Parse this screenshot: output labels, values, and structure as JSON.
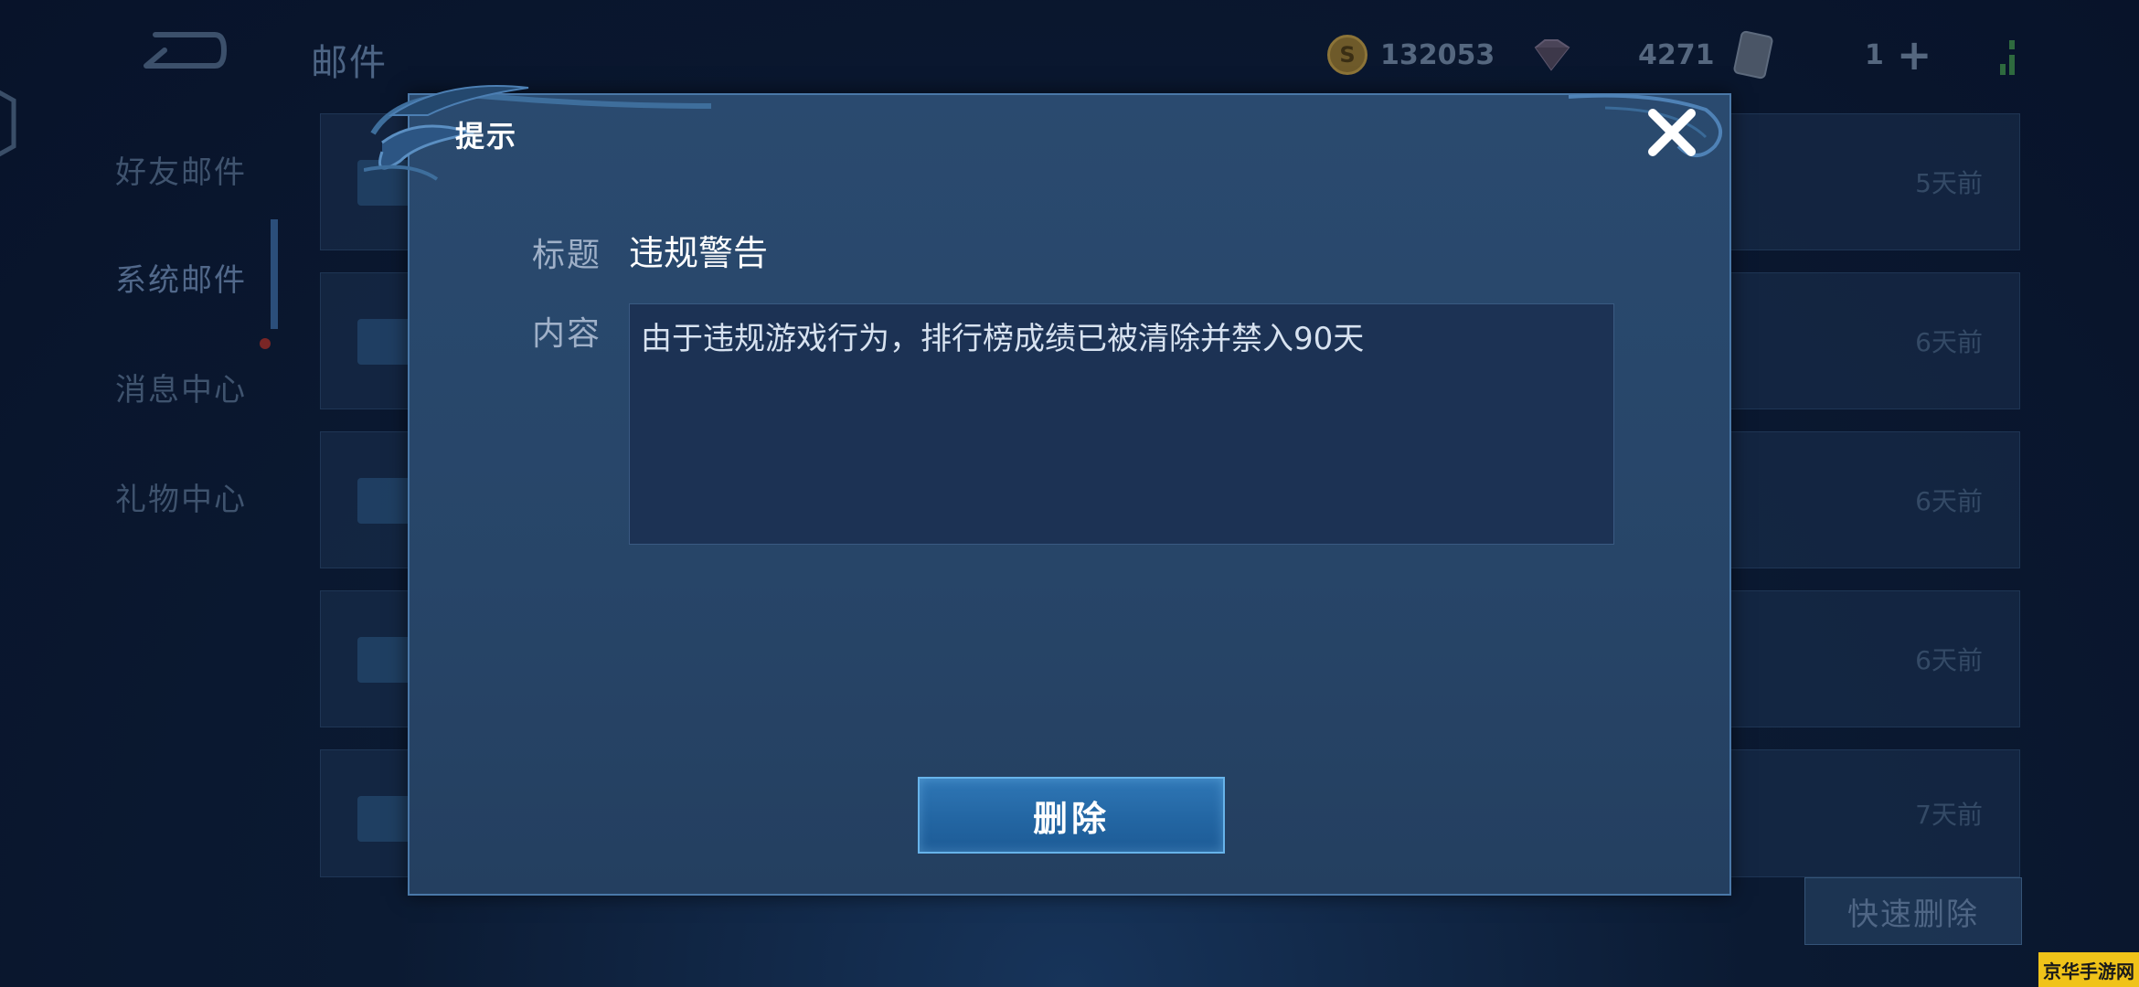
{
  "header": {
    "title": "邮件",
    "gold": "132053",
    "diamonds": "4271",
    "cards": "1"
  },
  "sidebar": {
    "items": [
      {
        "label": "好友邮件"
      },
      {
        "label": "系统邮件"
      },
      {
        "label": "消息中心"
      },
      {
        "label": "礼物中心"
      }
    ]
  },
  "mail_list": {
    "rows": [
      {
        "time": "5天前"
      },
      {
        "time": "6天前"
      },
      {
        "time": "6天前"
      },
      {
        "time": "6天前"
      },
      {
        "time": "7天前"
      }
    ],
    "quick_delete_label": "快速删除"
  },
  "dialog": {
    "title": "提示",
    "subject_label": "标题",
    "subject": "违规警告",
    "content_label": "内容",
    "content": "由于违规游戏行为，排行榜成绩已被清除并禁入90天",
    "delete_label": "删除"
  },
  "watermark": "京华手游网",
  "colors": {
    "dialog_bg": "#274568",
    "dialog_border": "#4a78a8",
    "button_bg": "#2366a3",
    "button_border": "#67b3ea",
    "page_bg": "#0b1a32"
  },
  "icons": [
    "back-icon",
    "gold-coin-icon",
    "gem-icon",
    "card-icon",
    "plus-icon",
    "signal-icon",
    "close-icon"
  ]
}
